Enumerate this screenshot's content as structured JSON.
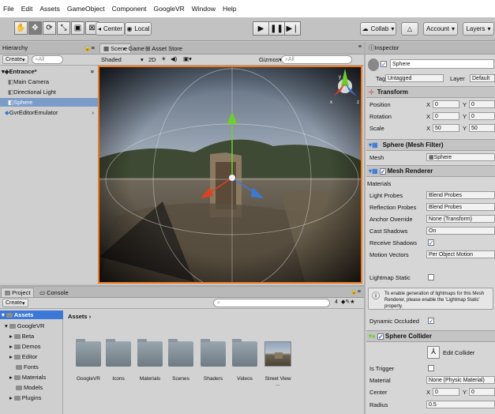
{
  "menu": [
    "File",
    "Edit",
    "Assets",
    "GameObject",
    "Component",
    "GoogleVR",
    "Window",
    "Help"
  ],
  "toolbar": {
    "pivot": "Center",
    "space": "Local",
    "collab": "Collab",
    "account": "Account",
    "layers": "Layers"
  },
  "hierarchy": {
    "tab": "Hierarchy",
    "create": "Create",
    "search": "All",
    "scene": "Entrance*",
    "items": [
      "Main Camera",
      "Directional Light",
      "Sphere",
      "GvrEditorEmulator"
    ]
  },
  "scene": {
    "tabs": [
      "Scene",
      "Game",
      "Asset Store"
    ],
    "shading": "Shaded",
    "mode2d": "2D",
    "gizmos": "Gizmos",
    "search": "All",
    "gizmo_axes": [
      "y",
      "x",
      "z"
    ]
  },
  "inspector": {
    "tab": "Inspector",
    "object_name": "Sphere",
    "tag_label": "Tag",
    "tag_value": "Untagged",
    "layer_label": "Layer",
    "layer_value": "Default",
    "transform": {
      "title": "Transform",
      "position_label": "Position",
      "rotation_label": "Rotation",
      "scale_label": "Scale",
      "position": {
        "x": "0",
        "y": "0"
      },
      "rotation": {
        "x": "0",
        "y": "0"
      },
      "scale": {
        "x": "50",
        "y": "50"
      }
    },
    "mesh_filter": {
      "title": "Sphere (Mesh Filter)",
      "mesh_label": "Mesh",
      "mesh_value": "Sphere"
    },
    "mesh_renderer": {
      "title": "Mesh Renderer",
      "materials_label": "Materials",
      "light_probes_label": "Light Probes",
      "light_probes_value": "Blend Probes",
      "reflection_probes_label": "Reflection Probes",
      "reflection_probes_value": "Blend Probes",
      "anchor_override_label": "Anchor Override",
      "anchor_override_value": "None (Transform)",
      "cast_shadows_label": "Cast Shadows",
      "cast_shadows_value": "On",
      "receive_shadows_label": "Receive Shadows",
      "motion_vectors_label": "Motion Vectors",
      "motion_vectors_value": "Per Object Motion",
      "lightmap_static_label": "Lightmap Static",
      "info": "To enable generation of lightmaps for this Mesh Renderer, please enable the 'Lightmap Static' property.",
      "dynamic_occluded_label": "Dynamic Occluded"
    },
    "sphere_collider": {
      "title": "Sphere Collider",
      "edit_collider": "Edit Collider",
      "is_trigger_label": "Is Trigger",
      "material_label": "Material",
      "material_value": "None (Physic Material)",
      "center_label": "Center",
      "center": {
        "x": "0",
        "y": "0"
      },
      "radius_label": "Radius",
      "radius_value": "0.5"
    }
  },
  "project": {
    "tabs": [
      "Project",
      "Console"
    ],
    "create": "Create",
    "assets_root": "Assets",
    "breadcrumb": "Assets",
    "count": "4",
    "tree": [
      "GoogleVR",
      "Beta",
      "Demos",
      "Editor",
      "Fonts",
      "Materials",
      "Models",
      "Plugins"
    ],
    "grid": [
      "GoogleVR",
      "Icons",
      "Materials",
      "Scenes",
      "Shaders",
      "Videos",
      "Street View ..."
    ]
  },
  "colors": {
    "accent": "#3b78d8",
    "scene_border": "#f07a1e",
    "selection": "#7a9cc9"
  }
}
